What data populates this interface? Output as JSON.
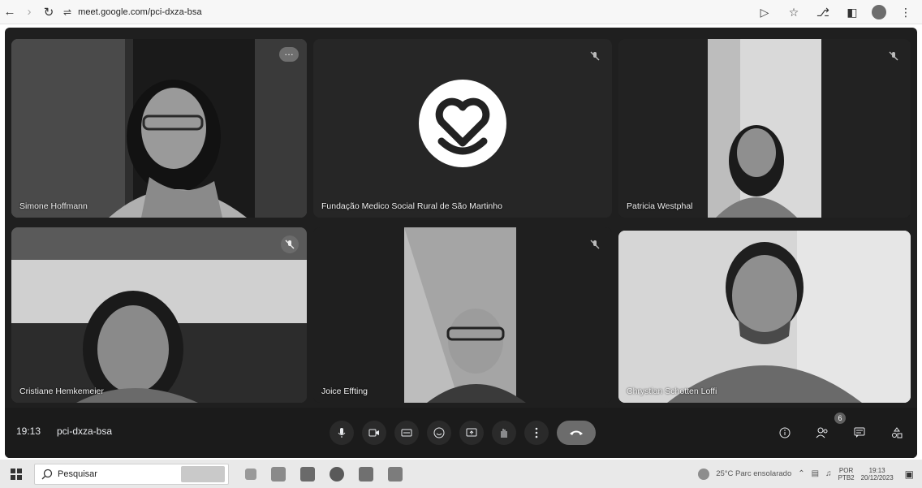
{
  "browser": {
    "url": "meet.google.com/pci-dxza-bsa",
    "back_icon": "arrow-left-icon",
    "forward_icon": "arrow-right-icon",
    "reload_icon": "reload-icon"
  },
  "meeting": {
    "time": "19:13",
    "code": "pci-dxza-bsa",
    "participant_count_badge": "6"
  },
  "tiles": [
    {
      "name": "Simone Hoffmann",
      "state": "speaking"
    },
    {
      "name": "Fundação Medico Social Rural de São Martinho",
      "state": "muted"
    },
    {
      "name": "Patricia Westphal",
      "state": "muted"
    },
    {
      "name": "Cristiane Hemkemeier",
      "state": "muted"
    },
    {
      "name": "Joice Effting",
      "state": "muted"
    },
    {
      "name": "Chrystian Schotten Loffi",
      "state": ""
    }
  ],
  "taskbar": {
    "search_placeholder": "Pesquisar",
    "weather": "25°C  Parc ensolarado",
    "lang_top": "POR",
    "lang_bottom": "PTB2",
    "clock_top": "19:13",
    "clock_bottom": "20/12/2023"
  },
  "colors": {
    "meet_bg": "#1f1f1f",
    "end_call": "#6c6c6c",
    "taskbar_bg": "#e9e9e9"
  }
}
